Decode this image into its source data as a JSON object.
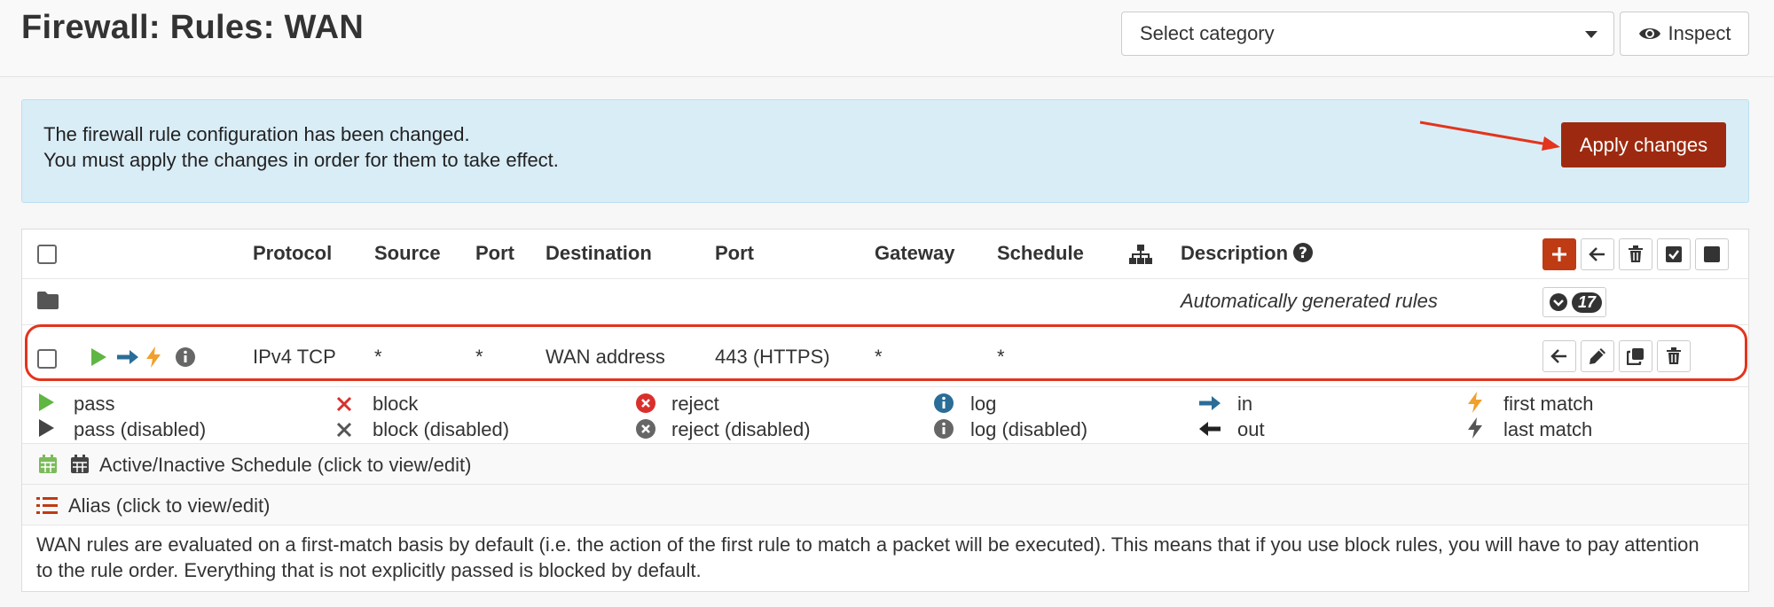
{
  "header": {
    "title": "Firewall: Rules: WAN",
    "category_select": "Select category",
    "inspect_label": "Inspect"
  },
  "alert": {
    "line1": "The firewall rule configuration has been changed.",
    "line2": "You must apply the changes in order for them to take effect.",
    "apply_label": "Apply changes"
  },
  "table": {
    "headers": {
      "protocol": "Protocol",
      "source": "Source",
      "port": "Port",
      "destination": "Destination",
      "dest_port": "Port",
      "gateway": "Gateway",
      "schedule": "Schedule",
      "description": "Description"
    },
    "auto_group": {
      "label": "Automatically generated rules",
      "count": "17"
    },
    "rule": {
      "protocol": "IPv4 TCP",
      "source": "*",
      "port": "*",
      "destination": "WAN address",
      "dest_port": "443 (HTTPS)",
      "gateway": "*",
      "schedule": "*"
    }
  },
  "legend": {
    "pass": "pass",
    "pass_disabled": "pass (disabled)",
    "block": "block",
    "block_disabled": "block (disabled)",
    "reject": "reject",
    "reject_disabled": "reject (disabled)",
    "log": "log",
    "log_disabled": "log (disabled)",
    "in": "in",
    "out": "out",
    "first_match": "first match",
    "last_match": "last match"
  },
  "footer": {
    "schedule_note": "Active/Inactive Schedule (click to view/edit)",
    "alias_note": "Alias (click to view/edit)",
    "info_line1": "WAN rules are evaluated on a first-match basis by default (i.e. the action of the first rule to match a packet will be executed). This means that if you use block rules, you will have to pay attention",
    "info_line2": "to the rule order. Everything that is not explicitly passed is blocked by default."
  },
  "colors": {
    "accent_red": "#9d2a10",
    "alert_bg": "#d9edf7",
    "pass_green": "#5fb643",
    "in_blue": "#2a6d97",
    "lightning_orange": "#f0a02c",
    "block_red": "#d9302c",
    "annotation_red": "#e3341c"
  }
}
